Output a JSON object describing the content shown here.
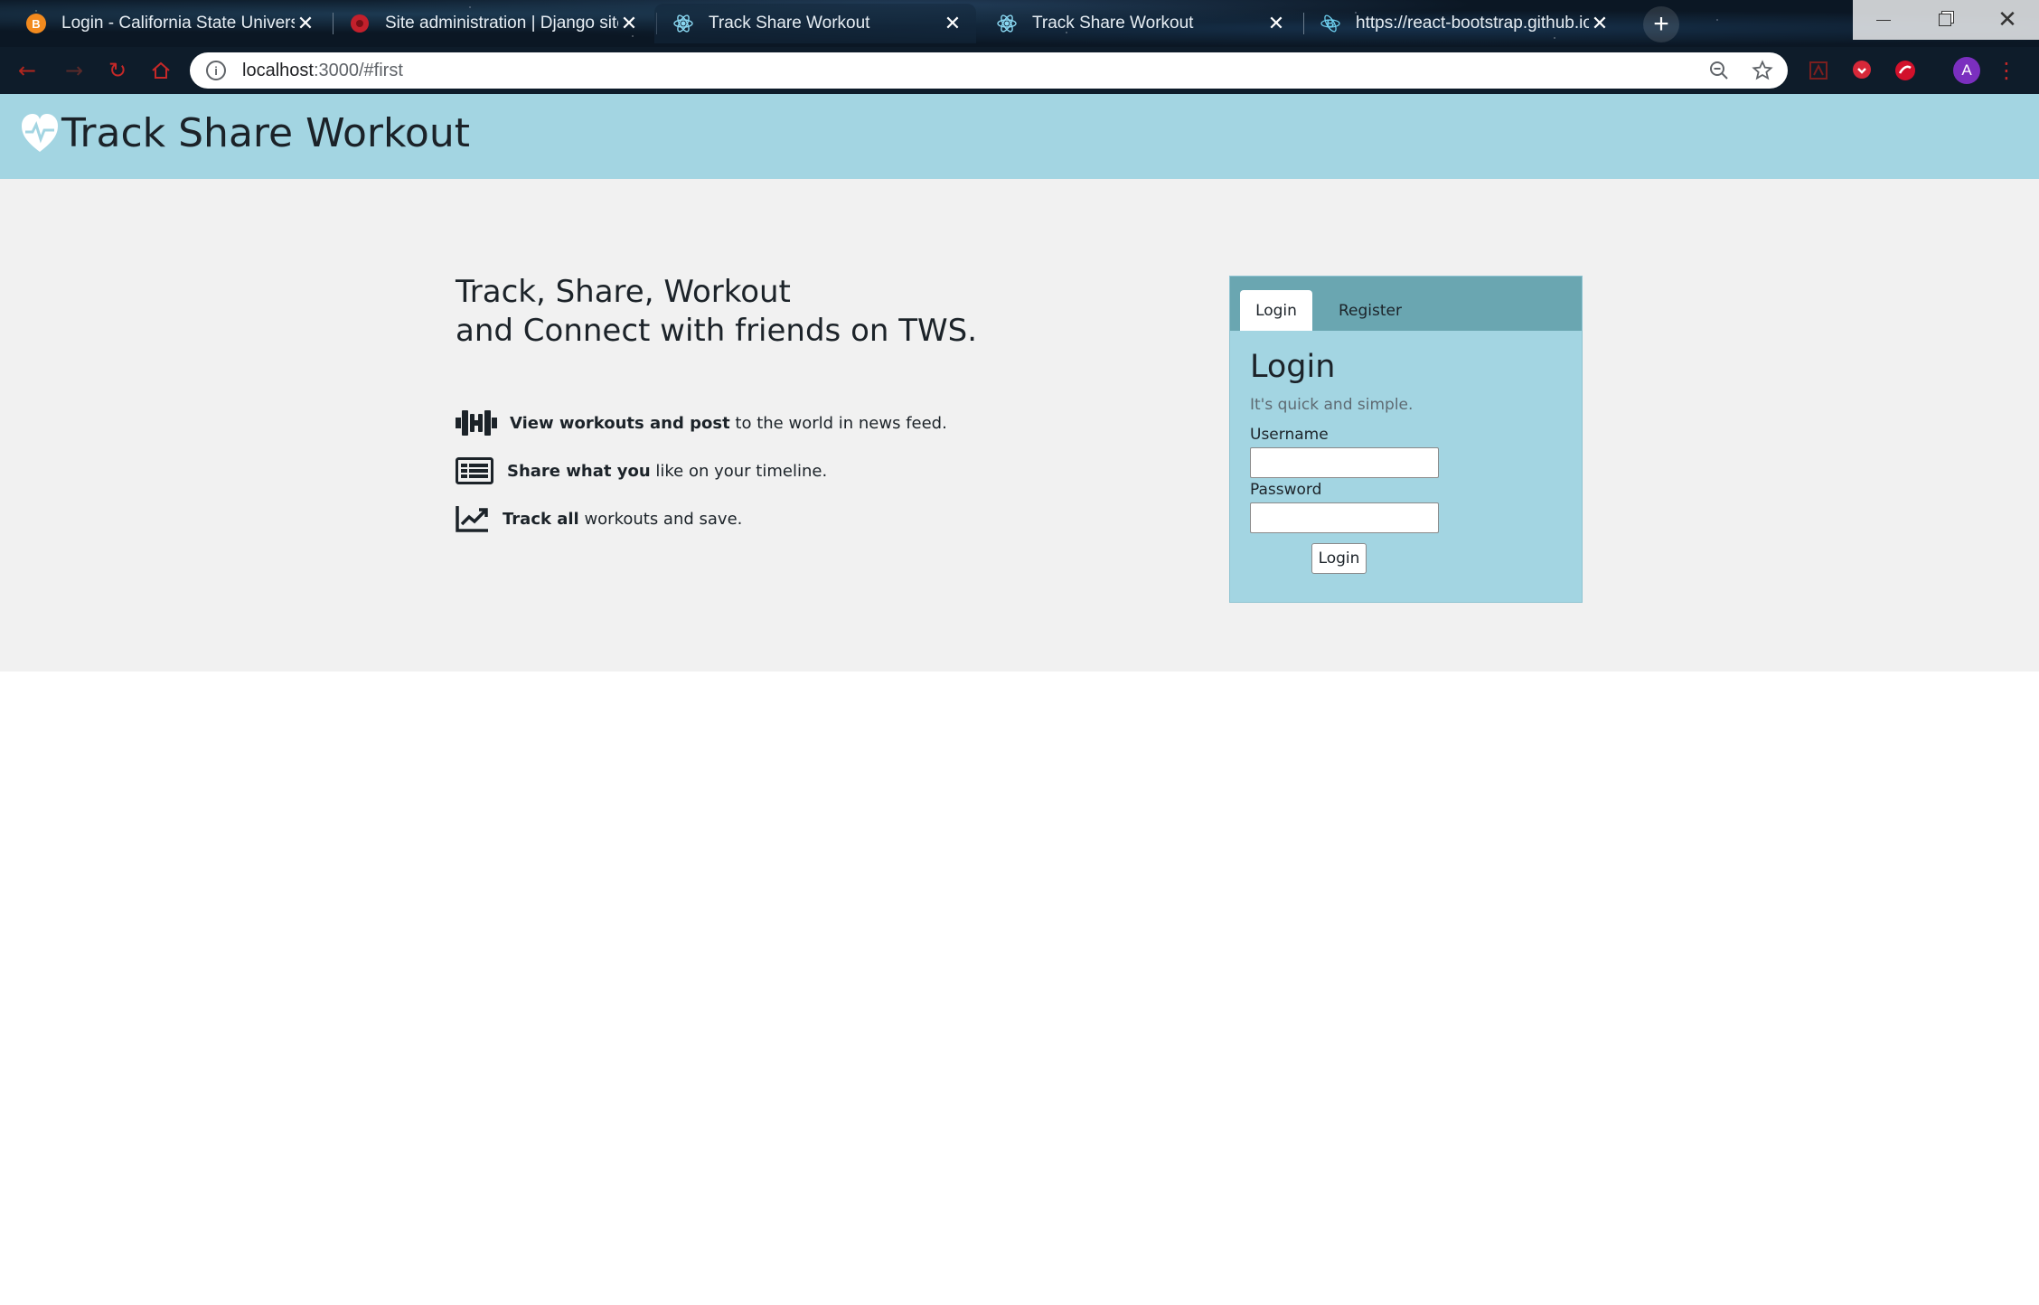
{
  "browser": {
    "tabs": [
      {
        "title": "Login - California State Universit",
        "favicon": "moodle-icon"
      },
      {
        "title": "Site administration | Django site",
        "favicon": "django-icon"
      },
      {
        "title": "Track Share Workout",
        "favicon": "react-icon"
      },
      {
        "title": "Track Share Workout",
        "favicon": "react-icon"
      },
      {
        "title": "https://react-bootstrap.github.io",
        "favicon": "bootstrap-icon"
      }
    ],
    "address": {
      "host": "localhost",
      "rest": ":3000/#first"
    }
  },
  "header": {
    "brand": "Track Share Workout"
  },
  "hero": {
    "tagline_line1": "Track, Share, Workout",
    "tagline_line2": "and Connect with friends on TWS."
  },
  "features": [
    {
      "icon": "dumbbell-icon",
      "bold": "View workouts and post",
      "text": " to the world in news feed."
    },
    {
      "icon": "newspaper-icon",
      "bold": "Share what you",
      "text": " like on your timeline."
    },
    {
      "icon": "chart-line-icon",
      "bold": "Track all",
      "text": " workouts and save."
    }
  ],
  "login_card": {
    "tab_login": "Login",
    "tab_register": "Register",
    "title": "Login",
    "subtitle": "It's quick and simple.",
    "username_label": "Username",
    "username_value": "",
    "password_label": "Password",
    "password_value": "",
    "button": "Login"
  },
  "colors": {
    "header_bg": "#a3d5e2",
    "hero_bg": "#f1f1f1",
    "card_tabs_bg": "#6aa6b1"
  }
}
